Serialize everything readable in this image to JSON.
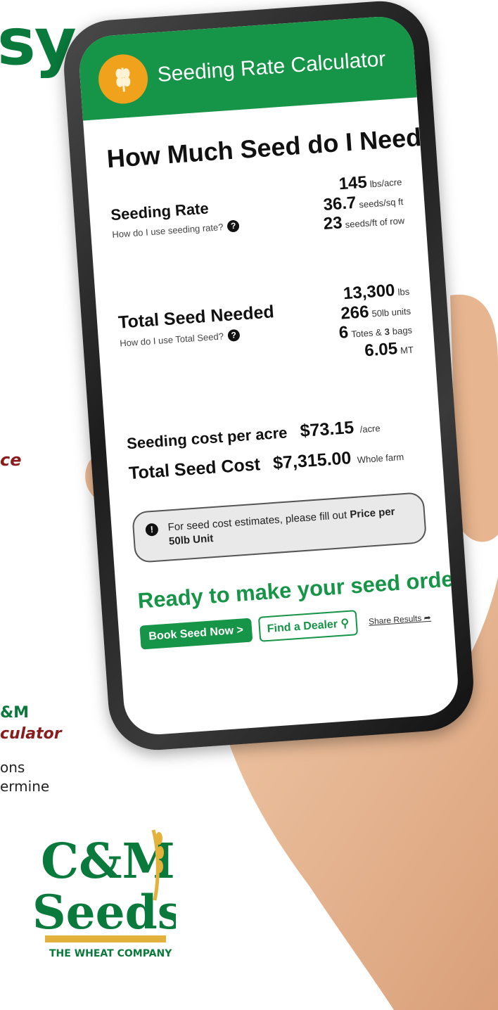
{
  "page_fragments": {
    "heading_tail": "sy",
    "italic_tail": "ce",
    "brand_tail": "&M",
    "calculator_tail": "culator",
    "body_line_1": "ons",
    "body_line_2": "ermine"
  },
  "logo": {
    "line1": "C&M",
    "line2": "Seeds",
    "tagline": "THE WHEAT COMPANY"
  },
  "app": {
    "header_title": "Seeding Rate Calculator",
    "heading": "How Much Seed do I Need?",
    "seeding_rate": {
      "label": "Seeding Rate",
      "help": "How do I use seeding rate?",
      "values": [
        {
          "num": "145",
          "unit": "lbs/acre"
        },
        {
          "num": "36.7",
          "unit": "seeds/sq ft"
        },
        {
          "num": "23",
          "unit": "seeds/ft of row"
        }
      ]
    },
    "total_seed": {
      "label": "Total Seed Needed",
      "help": "How do I use Total Seed?",
      "values": [
        {
          "num": "13,300",
          "unit": "lbs"
        },
        {
          "num": "266",
          "unit": "50lb units"
        },
        {
          "num": "6",
          "unit": "Totes &",
          "num2": "3",
          "unit2": "bags"
        },
        {
          "num": "6.05",
          "unit": "MT"
        }
      ]
    },
    "cost_per_acre": {
      "label": "Seeding cost per acre",
      "value": "$73.15",
      "unit": "/acre"
    },
    "total_cost": {
      "label": "Total Seed Cost",
      "value": "$7,315.00",
      "unit": "Whole farm"
    },
    "notice": {
      "text": "For seed cost estimates, please fill out",
      "bold": "Price per 50lb Unit"
    },
    "cta": "Ready to make your seed order?",
    "buttons": {
      "book": "Book Seed Now >",
      "dealer": "Find a Dealer",
      "share": "Share Results"
    }
  },
  "colors": {
    "brand_green": "#169447",
    "accent_orange": "#f0a21c",
    "maroon": "#8b1c1c"
  }
}
